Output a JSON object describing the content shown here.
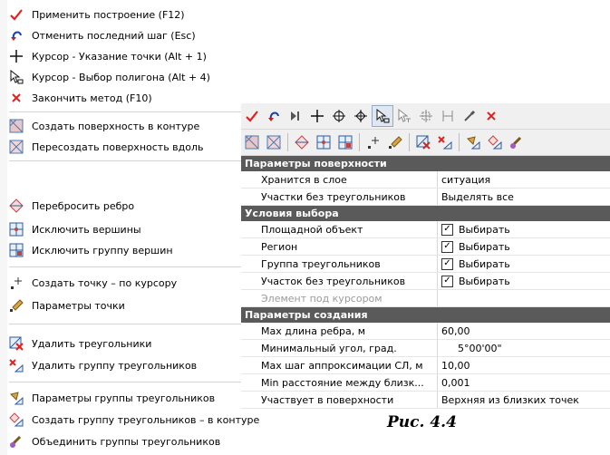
{
  "menu": {
    "items": [
      {
        "label": "Применить построение (F12)",
        "icon": "checkmark-icon"
      },
      {
        "label": "Отменить последний шаг (Esc)",
        "icon": "undo-arrow-icon"
      },
      {
        "label": "Курсор - Указание точки (Alt + 1)",
        "icon": "crosshair-icon"
      },
      {
        "label": "Курсор - Выбор полигона (Alt + 4)",
        "icon": "polygon-cursor-icon"
      },
      {
        "label": "Закончить метод (F10)",
        "icon": "red-x-icon"
      },
      {
        "label": "Создать поверхность в контуре",
        "icon": "surface-contour-icon"
      },
      {
        "label": "Пересоздать поверхность вдоль",
        "icon": "recreate-surface-icon"
      },
      {
        "label": "Перебросить ребро",
        "icon": "flip-edge-icon"
      },
      {
        "label": "Исключить вершины",
        "icon": "exclude-vertices-icon"
      },
      {
        "label": "Исключить группу вершин",
        "icon": "exclude-vertex-group-icon"
      },
      {
        "label": "Создать точку – по курсору",
        "icon": "create-point-icon"
      },
      {
        "label": "Параметры точки",
        "icon": "point-params-icon"
      },
      {
        "label": "Удалить треугольники",
        "icon": "delete-triangles-icon"
      },
      {
        "label": "Удалить группу треугольников",
        "icon": "delete-triangle-group-icon"
      },
      {
        "label": "Параметры группы треугольников",
        "icon": "triangle-group-params-icon"
      },
      {
        "label": "Создать группу треугольников – в контуре",
        "icon": "create-triangle-group-icon"
      },
      {
        "label": "Объединить группы треугольников",
        "icon": "merge-triangle-groups-icon"
      }
    ]
  },
  "panel": {
    "toolbar1": [
      "apply-checkmark-icon",
      "undo-arrow-icon",
      "step-icon",
      "crosshair-icon",
      "target-icon",
      "target-alt-icon",
      "polygon-cursor-icon",
      "polygon-cursor-t-icon",
      "snap-grid-icon",
      "measure-icon",
      "pipette-icon",
      "red-x-icon"
    ],
    "sections": [
      {
        "title": "Параметры поверхности",
        "rows": [
          {
            "name": "Хранится в слое",
            "value": "ситуация"
          },
          {
            "name": "Участки без треугольников",
            "value": "Выделять все"
          }
        ]
      },
      {
        "title": "Условия выбора",
        "rows": [
          {
            "name": "Площадной объект",
            "value": "Выбирать",
            "checked": "✓"
          },
          {
            "name": "Регион",
            "value": "Выбирать",
            "checked": "✓"
          },
          {
            "name": "Группа треугольников",
            "value": "Выбирать",
            "checked": "✓"
          },
          {
            "name": "Участок без треугольников",
            "value": "Выбирать",
            "checked": "✓"
          },
          {
            "name": "Элемент под курсором",
            "value": ""
          }
        ]
      },
      {
        "title": "Параметры создания",
        "rows": [
          {
            "name": "Max длина ребра, м",
            "value": "60,00"
          },
          {
            "name": "Минимальный угол, град.",
            "value": "5°00'00\""
          },
          {
            "name": "Max шаг аппроксимации СЛ, м",
            "value": "10,00"
          },
          {
            "name": "Min расстояние между близк...",
            "value": "0,001"
          },
          {
            "name": "Участвует в поверхности",
            "value": "Верхняя из близких точек"
          }
        ]
      }
    ]
  },
  "caption": "Рис. 4.4",
  "colors": {
    "accent_red": "#e0221f",
    "section_bg": "#5a5a5a"
  }
}
